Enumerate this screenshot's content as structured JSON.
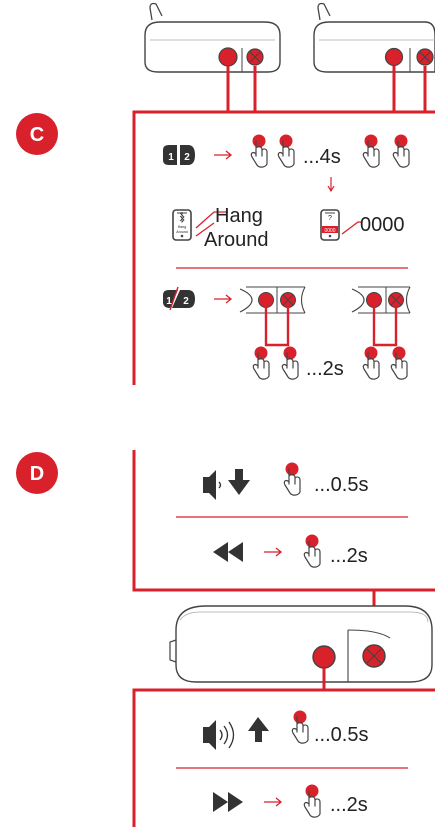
{
  "colors": {
    "accent": "#d9212c",
    "line": "#555555",
    "text": "#222222",
    "bg": "#ffffff"
  },
  "section_c": {
    "badge": "C",
    "pair_step": {
      "hold": "...4s",
      "speaker_name_line1": "Hang",
      "speaker_name_line2": "Around",
      "phone_label": "Hang Around",
      "pin_prompt": "?",
      "pin_screen": "0000",
      "pin_code": "0000"
    },
    "stereo_step": {
      "hold": "...2s",
      "speaker_a": "1",
      "speaker_b": "2"
    }
  },
  "section_d": {
    "badge": "D",
    "volume_down": {
      "hold": "...0.5s"
    },
    "previous_track": {
      "hold": "...2s"
    },
    "volume_up": {
      "hold": "...0.5s"
    },
    "next_track": {
      "hold": "...2s"
    }
  },
  "icons": [
    "speaker-device-icon",
    "hand-press-icon",
    "phone-bluetooth-icon",
    "phone-pin-icon",
    "volume-down-icon",
    "volume-up-icon",
    "arrow-down-icon",
    "arrow-up-icon",
    "rewind-icon",
    "fast-forward-icon",
    "speaker-number-badge-icon"
  ]
}
